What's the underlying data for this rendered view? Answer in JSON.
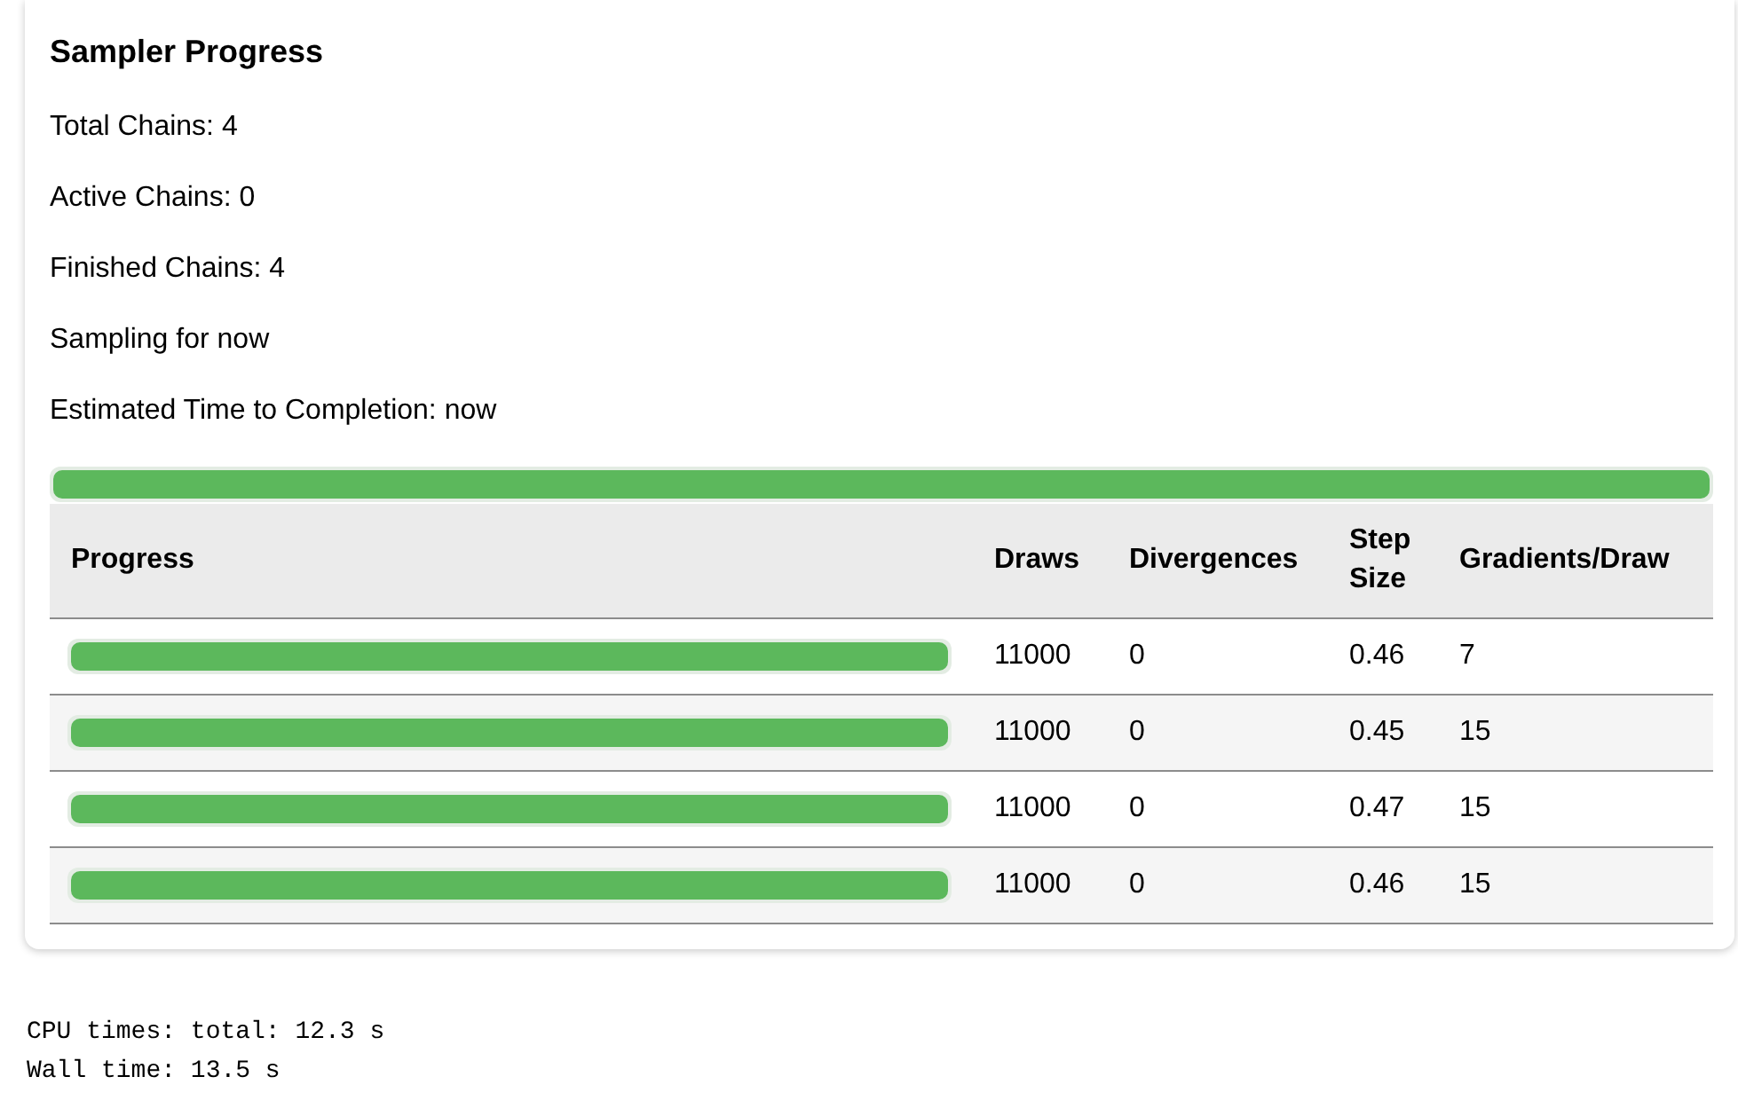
{
  "panel": {
    "title": "Sampler Progress",
    "stats": [
      "Total Chains: 4",
      "Active Chains: 0",
      "Finished Chains: 4",
      "Sampling for now",
      "Estimated Time to Completion: now"
    ],
    "overall_progress": {
      "level": 1.0
    },
    "table": {
      "columns": [
        "Progress",
        "Draws",
        "Divergences",
        "Step Size",
        "Gradients/Draw"
      ],
      "rows": [
        {
          "level": 1.0,
          "draws": "11000",
          "divergences": "0",
          "step_size": "0.46",
          "gradients_per_draw": "7"
        },
        {
          "level": 1.0,
          "draws": "11000",
          "divergences": "0",
          "step_size": "0.45",
          "gradients_per_draw": "15"
        },
        {
          "level": 1.0,
          "draws": "11000",
          "divergences": "0",
          "step_size": "0.47",
          "gradients_per_draw": "15"
        },
        {
          "level": 1.0,
          "draws": "11000",
          "divergences": "0",
          "step_size": "0.46",
          "gradients_per_draw": "15"
        }
      ]
    }
  },
  "output": [
    "CPU times: total: 12.3 s",
    "Wall time: 13.5 s"
  ]
}
